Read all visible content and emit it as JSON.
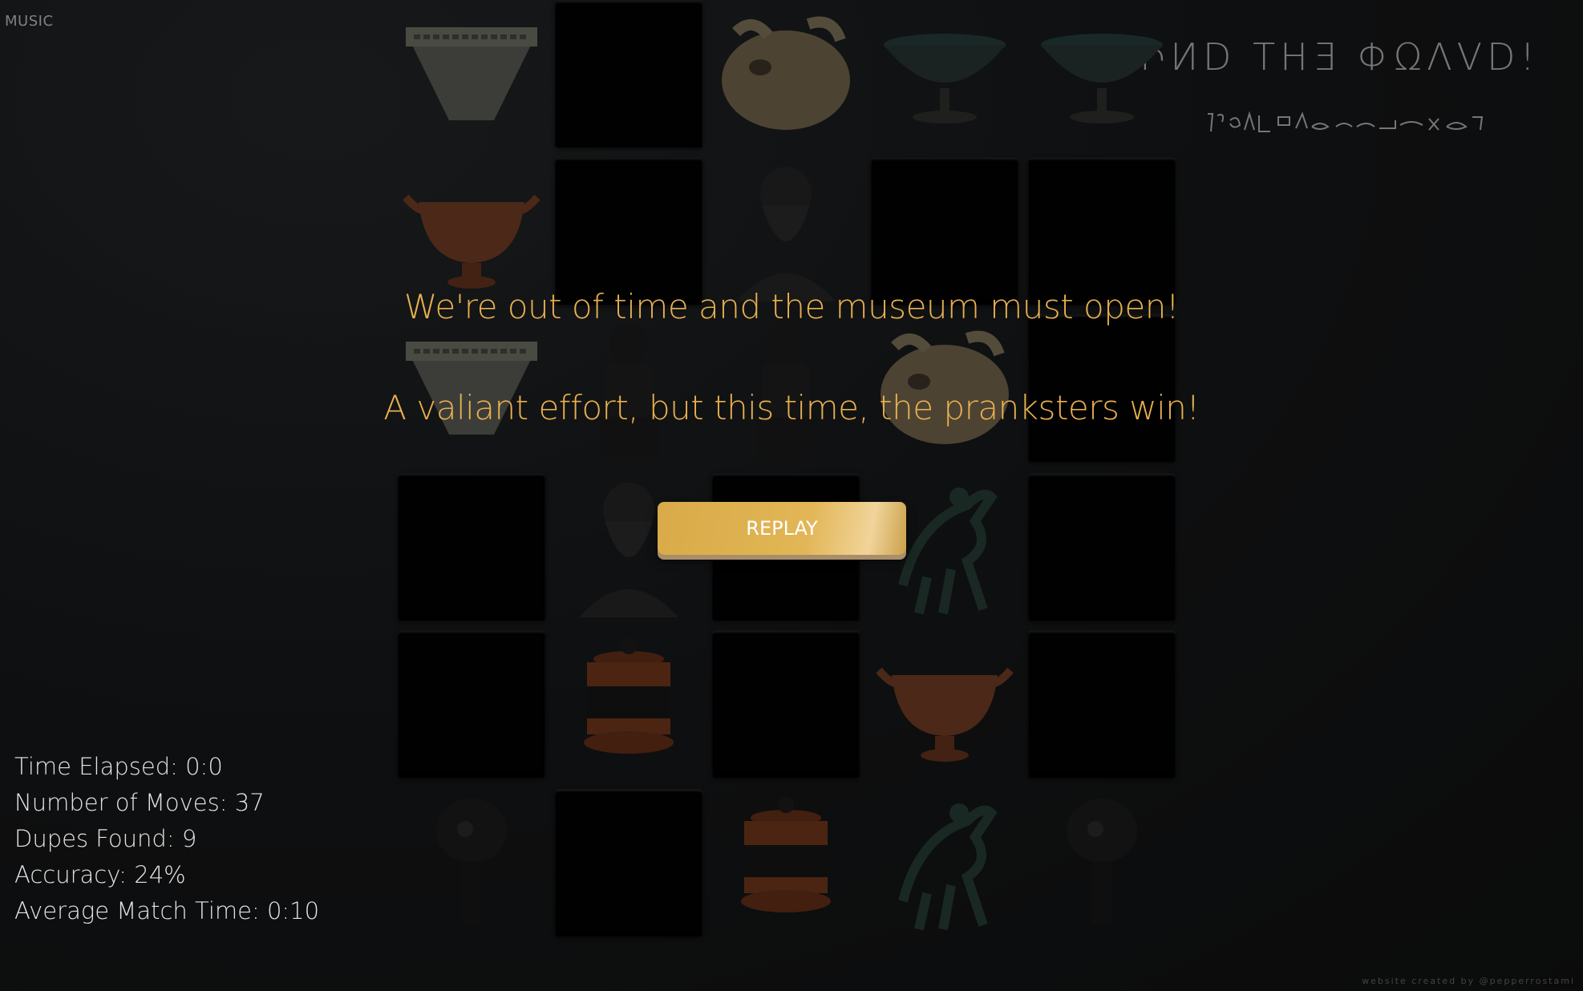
{
  "music": {
    "label": "MUSIC"
  },
  "header": {
    "title": "ΦԻИD THƎ ΦΩΛVD!",
    "subtitle_icon": "hieroglyph-script-icon"
  },
  "board": {
    "columns": 5,
    "rows": 6,
    "tiles": [
      {
        "artifact": "stone-bowl",
        "state": "revealed"
      },
      {
        "artifact": "",
        "state": "hidden"
      },
      {
        "artifact": "animal-head-vessel",
        "state": "revealed"
      },
      {
        "artifact": "footed-cup",
        "state": "revealed"
      },
      {
        "artifact": "footed-cup",
        "state": "revealed"
      },
      {
        "artifact": "red-kylix",
        "state": "revealed"
      },
      {
        "artifact": "",
        "state": "hidden"
      },
      {
        "artifact": "bearded-bust",
        "state": "revealed"
      },
      {
        "artifact": "",
        "state": "hidden"
      },
      {
        "artifact": "",
        "state": "hidden"
      },
      {
        "artifact": "stone-bowl",
        "state": "revealed"
      },
      {
        "artifact": "seated-statue",
        "state": "revealed"
      },
      {
        "artifact": "seated-statue",
        "state": "revealed"
      },
      {
        "artifact": "animal-head-vessel",
        "state": "revealed"
      },
      {
        "artifact": "",
        "state": "hidden"
      },
      {
        "artifact": "",
        "state": "hidden"
      },
      {
        "artifact": "bearded-bust",
        "state": "revealed"
      },
      {
        "artifact": "",
        "state": "hidden"
      },
      {
        "artifact": "bronze-horse",
        "state": "revealed"
      },
      {
        "artifact": "",
        "state": "hidden"
      },
      {
        "artifact": "",
        "state": "hidden"
      },
      {
        "artifact": "painted-pyxis",
        "state": "revealed"
      },
      {
        "artifact": "",
        "state": "hidden"
      },
      {
        "artifact": "red-kylix",
        "state": "revealed"
      },
      {
        "artifact": "",
        "state": "hidden"
      },
      {
        "artifact": "helmet-figure",
        "state": "revealed"
      },
      {
        "artifact": "",
        "state": "hidden"
      },
      {
        "artifact": "painted-pyxis",
        "state": "revealed"
      },
      {
        "artifact": "bronze-horse",
        "state": "revealed"
      },
      {
        "artifact": "helmet-figure",
        "state": "revealed"
      }
    ]
  },
  "game_over": {
    "line1": "We're out of time and the museum must open!",
    "line2": "A valiant effort, but this time, the pranksters win!",
    "replay_label": "REPLAY"
  },
  "stats": {
    "time_elapsed": "Time Elapsed: 0:0",
    "moves": "Number of Moves: 37",
    "dupes": "Dupes Found: 9",
    "accuracy": "Accuracy: 24%",
    "avg_match_time": "Average Match Time: 0:10"
  },
  "credit": "website created by @pepperrostami",
  "colors": {
    "accent": "#e8b04e",
    "button": "#dcae4e",
    "tile_back": "#020202"
  }
}
